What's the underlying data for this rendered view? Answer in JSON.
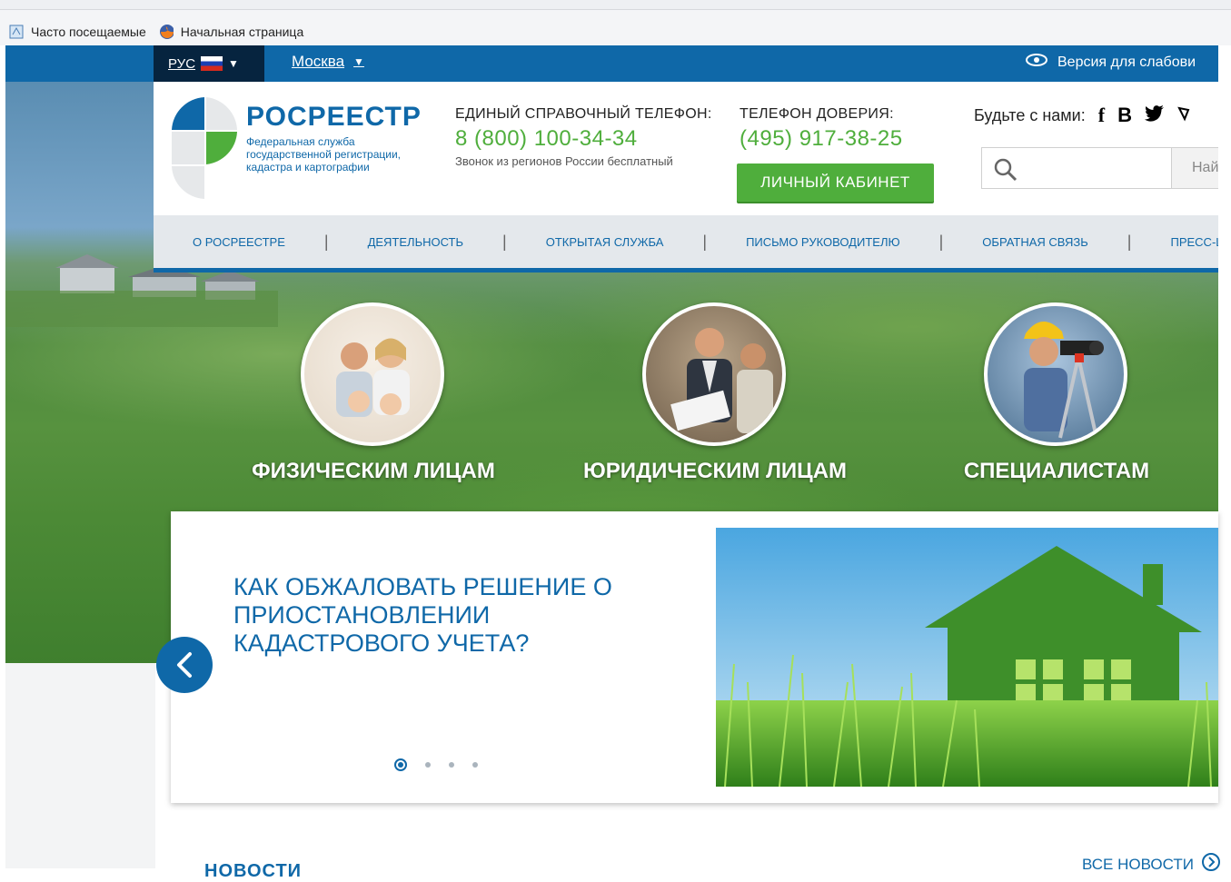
{
  "browser": {
    "bookmarks": [
      {
        "label": "Часто посещаемые",
        "icon": "bookmark-icon"
      },
      {
        "label": "Начальная страница",
        "icon": "firefox-icon"
      }
    ]
  },
  "topbar": {
    "lang": "РУС",
    "city": "Москва",
    "low_vision": "Версия для слабови"
  },
  "logo": {
    "title": "РОСРЕЕСТР",
    "subtitle": "Федеральная служба государственной регистрации, кадастра и картографии"
  },
  "contacts": {
    "hotline_label": "ЕДИНЫЙ СПРАВОЧНЫЙ ТЕЛЕФОН:",
    "hotline_phone": "8 (800) 100-34-34",
    "hotline_note": "Звонок из регионов России бесплатный",
    "trust_label": "ТЕЛЕФОН ДОВЕРИЯ:",
    "trust_phone": "(495) 917-38-25",
    "cabinet_button": "ЛИЧНЫЙ КАБИНЕТ"
  },
  "social": {
    "label": "Будьте с нами:",
    "icons": [
      "facebook-icon",
      "vk-icon",
      "twitter-icon",
      "other-social-icon"
    ],
    "vk_glyph": "В"
  },
  "search": {
    "button_label": "Най"
  },
  "nav": {
    "items": [
      "О РОСРЕЕСТРЕ",
      "ДЕЯТЕЛЬНОСТЬ",
      "ОТКРЫТАЯ СЛУЖБА",
      "ПИСЬМО РУКОВОДИТЕЛЮ",
      "ОБРАТНАЯ СВЯЗЬ",
      "ПРЕСС-ЦЕ"
    ]
  },
  "audiences": [
    {
      "label": "ФИЗИЧЕСКИМ ЛИЦАМ"
    },
    {
      "label": "ЮРИДИЧЕСКИМ ЛИЦАМ"
    },
    {
      "label": "СПЕЦИАЛИСТАМ"
    }
  ],
  "slider": {
    "title": "КАК ОБЖАЛОВАТЬ РЕШЕНИЕ О ПРИОСТАНОВЛЕНИИ КАДАСТРОВОГО УЧЕТА?",
    "active_slide": 1,
    "slide_count": 4
  },
  "news": {
    "all_news": "ВСЕ НОВОСТИ",
    "heading": "НОВОСТИ"
  },
  "colors": {
    "brand_blue": "#0f68a8",
    "brand_green": "#4fae3c",
    "dark_navy": "#06243f"
  }
}
